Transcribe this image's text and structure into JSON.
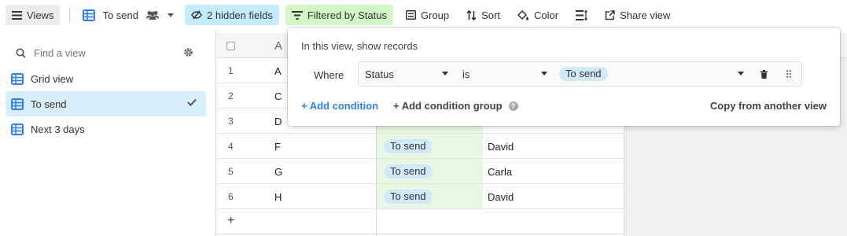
{
  "toolbar": {
    "views_label": "Views",
    "current_view": "To send",
    "hidden_fields": "2 hidden fields",
    "filtered_by": "Filtered by Status",
    "group": "Group",
    "sort": "Sort",
    "color": "Color",
    "share": "Share view"
  },
  "sidebar": {
    "search_placeholder": "Find a view",
    "items": [
      {
        "label": "Grid view",
        "icon": "grid-icon",
        "active": false
      },
      {
        "label": "To send",
        "icon": "grid-icon",
        "active": true
      },
      {
        "label": "Next 3 days",
        "icon": "grid-icon",
        "active": false
      }
    ]
  },
  "grid": {
    "primary_header": "A",
    "rows": [
      {
        "num": "1",
        "name": "A",
        "status": "",
        "person": ""
      },
      {
        "num": "2",
        "name": "C",
        "status": "",
        "person": ""
      },
      {
        "num": "3",
        "name": "D",
        "status": "",
        "person": ""
      },
      {
        "num": "4",
        "name": "F",
        "status": "To send",
        "person": "David"
      },
      {
        "num": "5",
        "name": "G",
        "status": "To send",
        "person": "Carla"
      },
      {
        "num": "6",
        "name": "H",
        "status": "To send",
        "person": "David"
      }
    ],
    "add_row": "+"
  },
  "filter": {
    "title": "In this view, show records",
    "where": "Where",
    "field": "Status",
    "operator": "is",
    "value": "To send",
    "add_condition": "+ Add condition",
    "add_condition_group": "+ Add condition group",
    "help": "?",
    "copy_from": "Copy from another view"
  },
  "colors": {
    "accent_blue": "#2d7ff9",
    "hidden_bg": "#c4ecff",
    "filter_bg": "#d1f7c4",
    "active_view_bg": "#d9eefb",
    "pill_bg": "#d0e9fb",
    "grid_icon": "#2d7ff9"
  }
}
